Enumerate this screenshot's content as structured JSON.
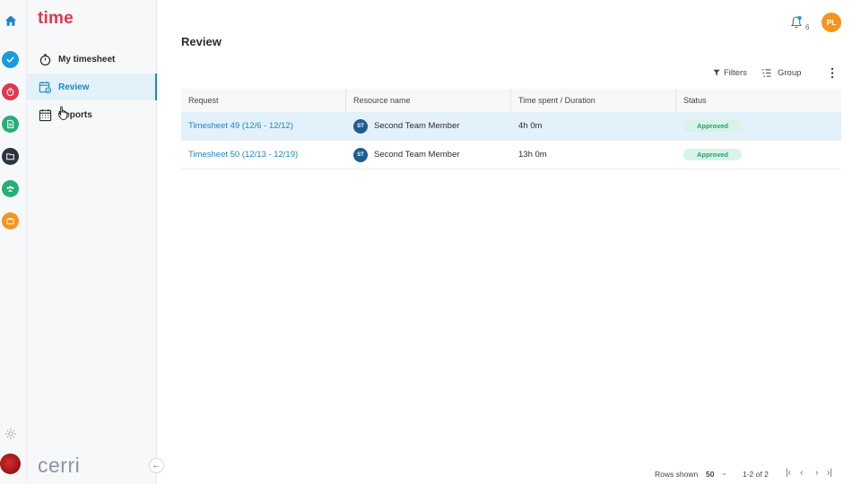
{
  "app": {
    "brand": "time",
    "footer_logo": "cerri",
    "page_title": "Review",
    "notifications_count": "6",
    "user_initials": "PL"
  },
  "rail": {
    "items": [
      {
        "icon": "home-icon",
        "color": "#1a86c8"
      },
      {
        "icon": "check-icon",
        "color": "#1a9be0"
      },
      {
        "icon": "stopwatch-icon",
        "color": "#e2364e"
      },
      {
        "icon": "document-icon",
        "color": "#27ae78"
      },
      {
        "icon": "folder-icon",
        "color": "#2a3340"
      },
      {
        "icon": "team-icon",
        "color": "#27ae78"
      },
      {
        "icon": "briefcase-icon",
        "color": "#f5941e"
      },
      {
        "icon": "settings-icon",
        "color": "#b0b6bd"
      }
    ]
  },
  "nav": {
    "items": [
      {
        "label": "My timesheet",
        "icon": "stopwatch-icon"
      },
      {
        "label": "Review",
        "icon": "review-calendar-icon",
        "active": true
      },
      {
        "label": "Reports",
        "icon": "calendar-grid-icon"
      }
    ]
  },
  "toolbar": {
    "filters_label": "Filters",
    "group_label": "Group"
  },
  "table": {
    "columns": [
      "Request",
      "Resource name",
      "Time spent / Duration",
      "Status"
    ],
    "rows": [
      {
        "request": "Timesheet 49 (12/6 - 12/12)",
        "resource_initials": "ST",
        "resource": "Second Team Member",
        "time": "4h 0m",
        "status": "Approved"
      },
      {
        "request": "Timesheet 50 (12/13 - 12/19)",
        "resource_initials": "ST",
        "resource": "Second Team Member",
        "time": "13h 0m",
        "status": "Approved"
      }
    ]
  },
  "pagination": {
    "rows_label": "Rows shown",
    "rows_value": "50",
    "range": "1-2 of 2"
  },
  "colors": {
    "accent": "#1a86c8",
    "brand": "#e2364e",
    "approved_bg": "#d6f4e7",
    "approved_text": "#2c9b6a"
  }
}
